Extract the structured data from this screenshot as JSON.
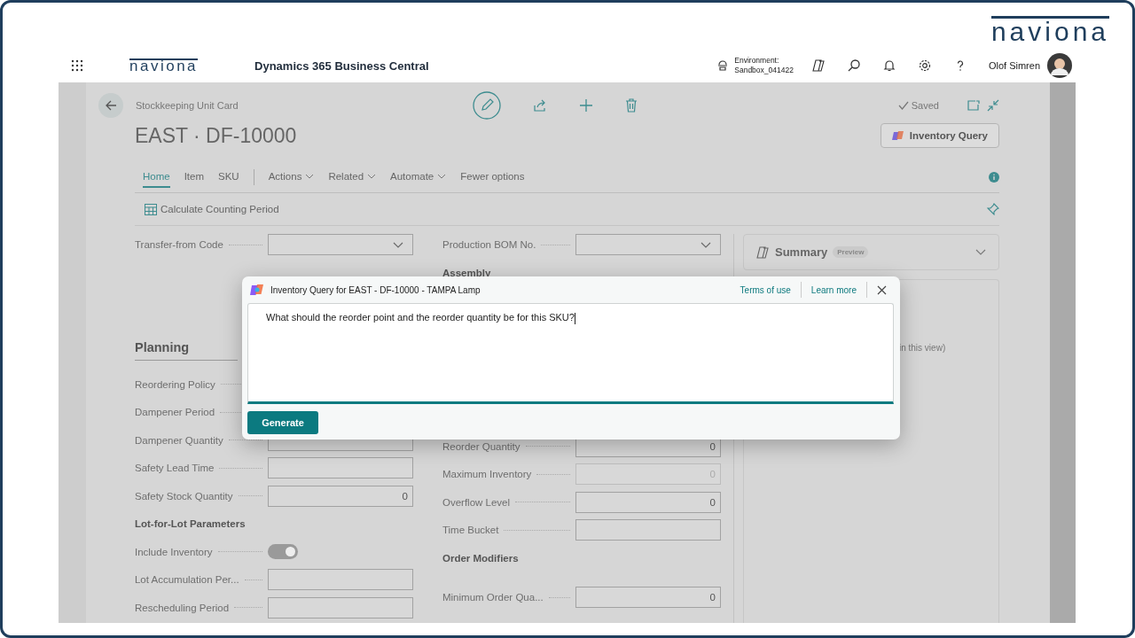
{
  "frame": {
    "logo": "naviona"
  },
  "app_bar": {
    "logo": "naviona",
    "product": "Dynamics 365 Business Central",
    "environment_label": "Environment:",
    "environment": "Sandbox_041422",
    "user": "Olof Simren"
  },
  "page": {
    "caption": "Stockkeeping Unit Card",
    "title": "EAST · DF-10000",
    "status": "Saved",
    "copilot_button": "Inventory Query",
    "action_tabs": [
      {
        "label": "Home",
        "selected": true,
        "dropdown": false
      },
      {
        "label": "Item",
        "selected": false,
        "dropdown": false
      },
      {
        "label": "SKU",
        "selected": false,
        "dropdown": false
      },
      {
        "label": "Actions",
        "selected": false,
        "dropdown": true
      },
      {
        "label": "Related",
        "selected": false,
        "dropdown": true
      },
      {
        "label": "Automate",
        "selected": false,
        "dropdown": true
      },
      {
        "label": "Fewer options",
        "selected": false,
        "dropdown": false
      }
    ],
    "secondary_action": "Calculate Counting Period"
  },
  "general_fields": [
    {
      "label": "Transfer-from Code",
      "kind": "dropdown"
    },
    {
      "label": "Production BOM No.",
      "kind": "dropdown"
    }
  ],
  "assembly_heading": "Assembly",
  "planning": {
    "heading": "Planning",
    "left": [
      {
        "kind": "covered",
        "label": "Reordering Policy"
      },
      {
        "kind": "covered",
        "label": "Dampener Period"
      },
      {
        "kind": "number",
        "label": "Dampener Quantity",
        "disabled": false
      },
      {
        "kind": "text",
        "label": "Safety Lead Time",
        "disabled": false
      },
      {
        "kind": "number",
        "label": "Safety Stock Quantity",
        "value": "0",
        "disabled": false
      },
      {
        "kind": "heading",
        "label": "Lot-for-Lot Parameters"
      },
      {
        "kind": "toggle",
        "label": "Include Inventory",
        "on": true
      },
      {
        "kind": "text",
        "label": "Lot Accumulation Per...",
        "disabled": false
      },
      {
        "kind": "text",
        "label": "Rescheduling Period",
        "disabled": false
      }
    ],
    "right": [
      {
        "kind": "number",
        "label": "Reorder Quantity",
        "value": "0",
        "disabled": false
      },
      {
        "kind": "number",
        "label": "Maximum Inventory",
        "value": "0",
        "disabled": true
      },
      {
        "kind": "number",
        "label": "Overflow Level",
        "value": "0",
        "disabled": false
      },
      {
        "kind": "text",
        "label": "Time Bucket",
        "disabled": false
      },
      {
        "kind": "heading",
        "label": "Order Modifiers"
      },
      {
        "kind": "number",
        "label": "Minimum Order Qua...",
        "value": "0",
        "disabled": false
      }
    ]
  },
  "summary": {
    "title": "Summary",
    "badge": "Preview",
    "note": "in this view)"
  },
  "dialog": {
    "title": "Inventory Query for EAST - DF-10000 - TAMPA Lamp",
    "links": [
      "Terms of use",
      "Learn more"
    ],
    "prompt": "What should the reorder point and the reorder quantity be for this SKU?",
    "button": "Generate"
  }
}
